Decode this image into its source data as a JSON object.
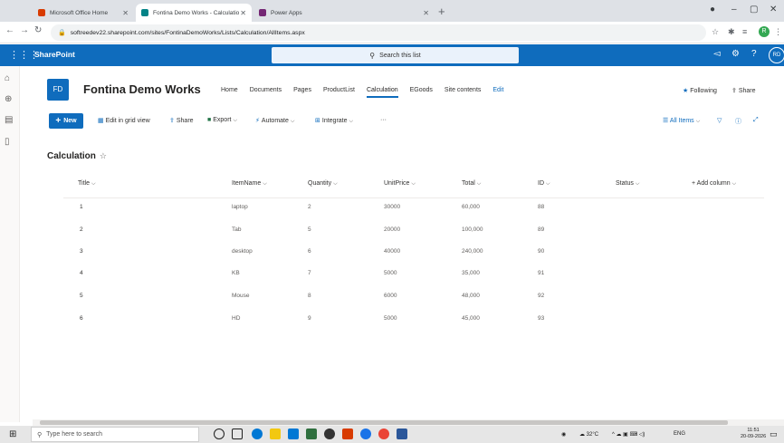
{
  "browser": {
    "tabs": [
      {
        "label": "Microsoft Office Home",
        "active": false,
        "icon_color": "#d83b01"
      },
      {
        "label": "Fontina Demo Works - Calculatio",
        "active": true,
        "icon_color": "#038387"
      },
      {
        "label": "Power Apps",
        "active": false,
        "icon_color": "#742774"
      }
    ],
    "new_tab": "+",
    "url": "softreedev22.sharepoint.com/sites/FontinaDemoWorks/Lists/Calculation/AllItems.aspx",
    "profile_initial": "R"
  },
  "suitebar": {
    "brand": "SharePoint",
    "search_placeholder": "Search this list",
    "avatar": "RD",
    "color": "#0f6cbd"
  },
  "site": {
    "logo": "FD",
    "title": "Fontina Demo Works",
    "nav": [
      "Home",
      "Documents",
      "Pages",
      "ProductList",
      "Calculation",
      "EGoods",
      "Site contents",
      "Edit"
    ],
    "active_nav": "Calculation",
    "following": "Following",
    "share": "Share"
  },
  "commandbar": {
    "new": "New",
    "edit_grid": "Edit in grid view",
    "share": "Share",
    "export": "Export",
    "automate": "Automate",
    "integrate": "Integrate",
    "more": "···",
    "view": "All Items"
  },
  "list": {
    "title": "Calculation",
    "columns": [
      "Title",
      "ItemName",
      "Quantity",
      "UnitPrice",
      "Total",
      "ID",
      "Status",
      "+ Add column"
    ],
    "rows": [
      {
        "title": "1",
        "item": "laptop",
        "qty": "2",
        "price": "30000",
        "total": "60,000",
        "id": "88"
      },
      {
        "title": "2",
        "item": "Tab",
        "qty": "5",
        "price": "20000",
        "total": "100,000",
        "id": "89"
      },
      {
        "title": "3",
        "item": "desktop",
        "qty": "6",
        "price": "40000",
        "total": "240,000",
        "id": "90"
      },
      {
        "title": "4",
        "item": "KB",
        "qty": "7",
        "price": "5000",
        "total": "35,000",
        "id": "91"
      },
      {
        "title": "5",
        "item": "Mouse",
        "qty": "8",
        "price": "6000",
        "total": "48,000",
        "id": "92"
      },
      {
        "title": "6",
        "item": "HD",
        "qty": "9",
        "price": "5000",
        "total": "45,000",
        "id": "93"
      }
    ]
  },
  "taskbar": {
    "search_placeholder": "Type here to search",
    "weather": "32°C",
    "lang": "ENG",
    "time": "11:51",
    "date": "20-09-2026",
    "apps": [
      "#1a73e8",
      "#0078d4",
      "#f2c811",
      "#0078d4",
      "#2f6f3e",
      "#333333",
      "#d83b01",
      "#1a73e8",
      "#ea4335",
      "#2b579a"
    ]
  }
}
